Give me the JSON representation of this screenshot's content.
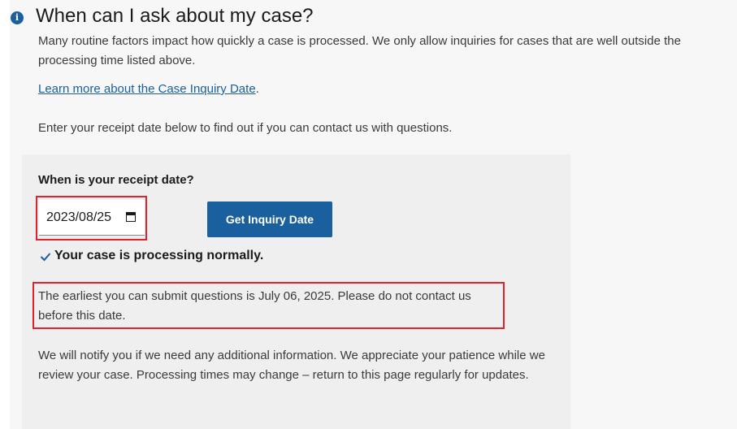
{
  "section": {
    "info_icon": "info-icon",
    "title": "When can I ask about my case?",
    "intro": "Many routine factors impact how quickly a case is processed. We only allow inquiries for cases that are well outside the processing time listed above.",
    "learn_more_link": "Learn more about the Case Inquiry Date",
    "learn_more_suffix": ".",
    "enter_prompt": "Enter your receipt date below to find out if you can contact us with questions."
  },
  "form": {
    "label": "When is your receipt date?",
    "date_value": "2023/08/25",
    "calendar_icon": "calendar-icon",
    "button_label": "Get Inquiry Date"
  },
  "result": {
    "check_icon": "checkmark-icon",
    "status": "Your case is processing normally.",
    "earliest": "The earliest you can submit questions is July 06, 2025. Please do not contact us before this date.",
    "notify": "We will notify you if we need any additional information. We appreciate your patience while we review your case. Processing times may change – return to this page regularly for updates."
  },
  "colors": {
    "accent": "#1a5f9e",
    "highlight": "#e4212b",
    "panel": "#f7f7f7",
    "form_box": "#efefef"
  }
}
